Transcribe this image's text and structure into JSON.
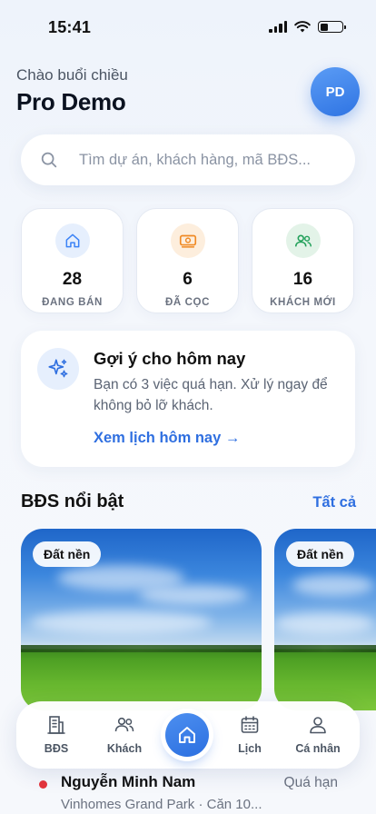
{
  "status_bar": {
    "time": "15:41"
  },
  "header": {
    "greeting": "Chào buổi chiều",
    "user_name": "Pro Demo",
    "avatar_initials": "PD"
  },
  "search": {
    "placeholder": "Tìm dự án, khách hàng, mã BĐS..."
  },
  "stats": [
    {
      "icon": "home-icon",
      "value": "28",
      "label": "ĐANG BÁN",
      "color": "#3b82f6"
    },
    {
      "icon": "money-icon",
      "value": "6",
      "label": "ĐÃ CỌC",
      "color": "#f08a24"
    },
    {
      "icon": "users-icon",
      "value": "16",
      "label": "KHÁCH MỚI",
      "color": "#22a05a"
    }
  ],
  "suggestion": {
    "title": "Gợi ý cho hôm nay",
    "text": "Bạn có 3 việc quá hạn. Xử lý ngay để không bỏ lỡ khách.",
    "link": "Xem lịch hôm nay →"
  },
  "featured": {
    "title": "BĐS nổi bật",
    "see_all": "Tất cả",
    "cards": [
      {
        "tag": "Đất nền"
      },
      {
        "tag": "Đất nền"
      }
    ]
  },
  "list_item": {
    "name": "Nguyễn Minh Nam",
    "status": "Quá hạn",
    "subtitle": "Vinhomes Grand Park · Căn 10..."
  },
  "nav": {
    "items": [
      {
        "label": "BĐS",
        "icon": "building-icon"
      },
      {
        "label": "Khách",
        "icon": "users-icon"
      },
      {
        "label": "",
        "icon": "home-icon"
      },
      {
        "label": "Lịch",
        "icon": "calendar-icon"
      },
      {
        "label": "Cá nhân",
        "icon": "user-icon"
      }
    ]
  },
  "colors": {
    "accent": "#2f6fe0",
    "overdue_dot": "#e5343b"
  }
}
